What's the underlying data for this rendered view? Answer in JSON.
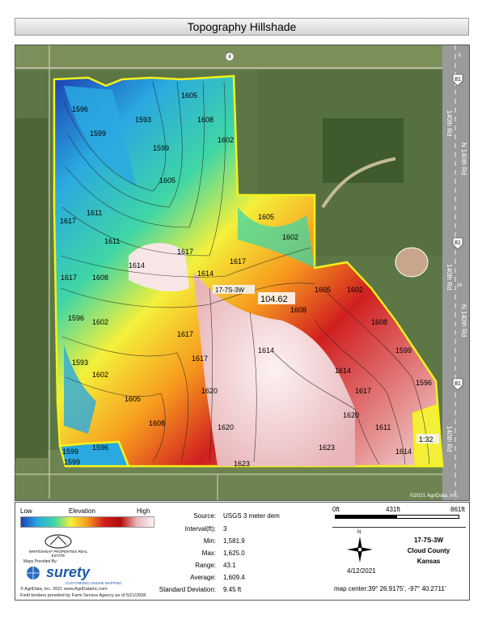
{
  "title": "Topography Hillshade",
  "map": {
    "copyright": "©2021 AgriData, Inc.",
    "acreage_label": "104.62",
    "section_label": "17-7S-3W",
    "small_area_label": "1:32",
    "roads": [
      "140th Rd",
      "N 140th Rd",
      "140th Rd",
      "N 140th Rd",
      "140th Rd"
    ],
    "route_shield": "81",
    "road_numbers": [
      "8",
      "9",
      "16"
    ],
    "contour_values": [
      "1590",
      "1593",
      "1596",
      "1599",
      "1602",
      "1605",
      "1608",
      "1611",
      "1614",
      "1617",
      "1620",
      "1623"
    ]
  },
  "legend": {
    "low_label": "Low",
    "elevation_label": "Elevation",
    "high_label": "High",
    "stats": [
      {
        "key": "Source:",
        "value": "USGS 3 meter dem"
      },
      {
        "key": "Interval(ft):",
        "value": "3"
      },
      {
        "key": "Min:",
        "value": "1,581.9"
      },
      {
        "key": "Max:",
        "value": "1,625.0"
      },
      {
        "key": "Range:",
        "value": "43.1"
      },
      {
        "key": "Average:",
        "value": "1,609.4"
      },
      {
        "key": "Standard Deviation:",
        "value": "9.45 ft"
      }
    ],
    "scale": {
      "zero": "0ft",
      "mid": "431ft",
      "end": "861ft"
    },
    "compass_n": "N",
    "date": "4/12/2021",
    "location": [
      "17-7S-3W",
      "Cloud County",
      "Kansas"
    ],
    "map_center": "map center:39° 26.9175',  -97° 40.2711'",
    "logo_company": "WHITESHEAF PROPERTIES REAL ESTATE",
    "maps_provided_by": "Maps Provided By:",
    "surety": "surety",
    "surety_tag": "CUSTOMIZED ONLINE MAPPING",
    "agridata_line": "© AgriData, Inc. 2021     www.AgriDataInc.com",
    "fsa_line": "Field borders provided by Farm Service Agency as of 5/21/2008."
  },
  "colors": {
    "low": "#1b3fb5",
    "mid": "#f4f03a",
    "high": "#d11f1f",
    "boundary": "#f4f21a",
    "imagery": "#4f6b3a"
  }
}
